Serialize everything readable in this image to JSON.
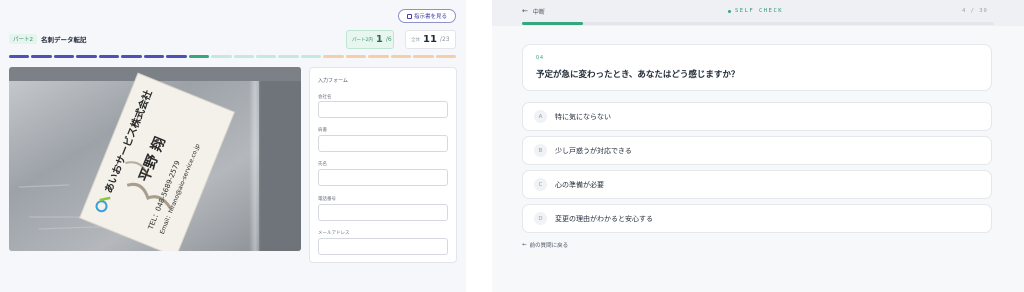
{
  "left": {
    "instructions_button": "指示書を見る",
    "part_tag": "パート2",
    "title": "名刺データ転記",
    "part_counter": {
      "label": "パート2内",
      "current": "1",
      "total": "/6"
    },
    "all_counter": {
      "label": "全体",
      "current": "11",
      "total": "/23"
    },
    "segments": [
      "done",
      "done",
      "done",
      "done",
      "done",
      "done",
      "done",
      "done",
      "cur",
      "p2",
      "p2",
      "p2",
      "p2",
      "p2",
      "p3",
      "p3",
      "p3",
      "p3",
      "p3",
      "p3"
    ],
    "card": {
      "company": "あいおサービス株式会社",
      "name": "平野 翔",
      "tel": "TEL：048-5689-2579",
      "email": "Email：hirano@aio-service.co.jp"
    },
    "form": {
      "title": "入力フォーム",
      "fields": [
        {
          "label": "会社名",
          "value": ""
        },
        {
          "label": "肩書",
          "value": ""
        },
        {
          "label": "氏名",
          "value": ""
        },
        {
          "label": "電話番号",
          "value": ""
        },
        {
          "label": "メールアドレス",
          "value": ""
        }
      ]
    }
  },
  "right": {
    "interrupt_label": "中断",
    "self_check": "SELF CHECK",
    "question_count": "4 / 30",
    "progress": 0.13,
    "question": {
      "number": "Q4",
      "text": "予定が急に変わったとき、あなたはどう感じますか？"
    },
    "options": [
      {
        "letter": "A",
        "text": "特に気にならない"
      },
      {
        "letter": "B",
        "text": "少し戸惑うが対応できる"
      },
      {
        "letter": "C",
        "text": "心の準備が必要"
      },
      {
        "letter": "D",
        "text": "変更の理由がわかると安心する"
      }
    ],
    "back_label": "前の質問に戻る"
  },
  "colors": {
    "accent_green": "#34a77c",
    "accent_indigo": "#4d51b8"
  }
}
